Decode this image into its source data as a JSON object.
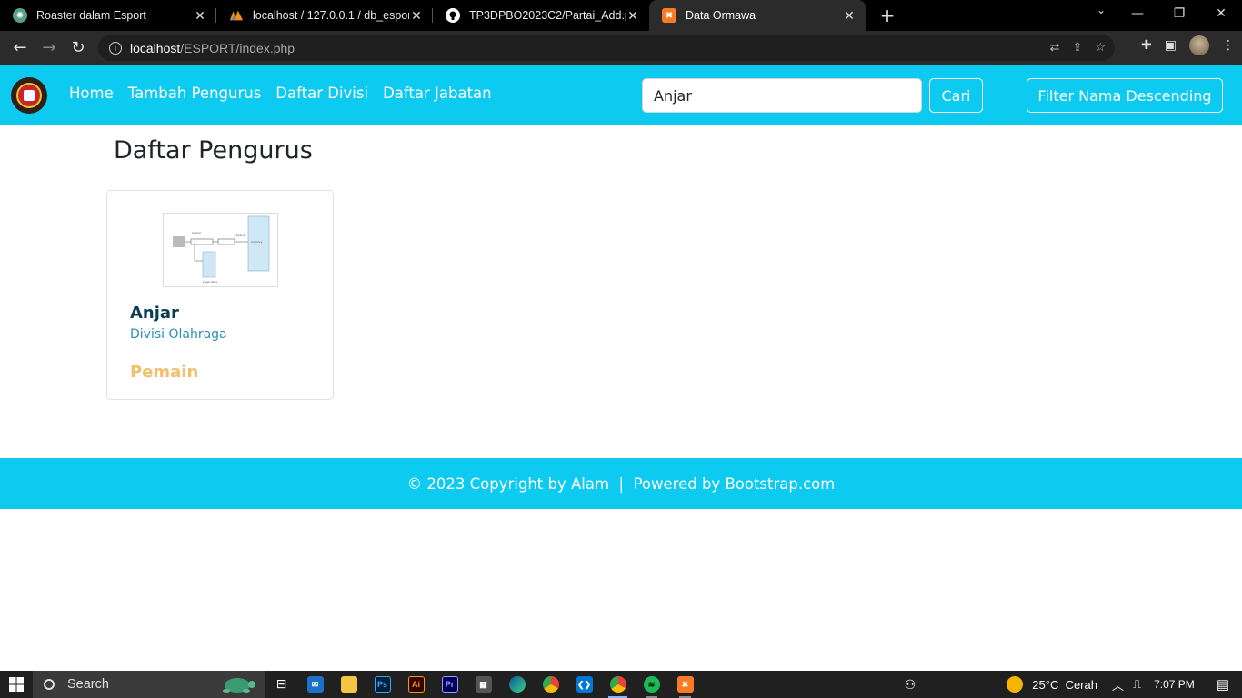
{
  "browser": {
    "tabs": [
      {
        "title": "Roaster dalam Esport",
        "icon": "chatgpt-icon",
        "active": false
      },
      {
        "title": "localhost / 127.0.0.1 / db_esport",
        "icon": "phpmyadmin-icon",
        "active": false
      },
      {
        "title": "TP3DPBO2023C2/Partai_Add.png",
        "icon": "github-icon",
        "active": false
      },
      {
        "title": "Data Ormawa",
        "icon": "xampp-icon",
        "active": true
      }
    ],
    "url_host": "localhost",
    "url_path": "/ESPORT/index.php"
  },
  "navbar": {
    "links": [
      "Home",
      "Tambah Pengurus",
      "Daftar Divisi",
      "Daftar Jabatan"
    ],
    "search_value": "Anjar",
    "search_button": "Cari",
    "filter_button": "Filter Nama Descending"
  },
  "main": {
    "title": "Daftar Pengurus",
    "cards": [
      {
        "name": "Anjar",
        "divisi": "Divisi Olahraga",
        "jabatan": "Pemain"
      }
    ]
  },
  "footer": {
    "text": "© 2023 Copyright by Alam  |  Powered by Bootstrap.com"
  },
  "taskbar": {
    "search_label": "Search",
    "weather": "25°C  Cerah",
    "time": "7:07 PM"
  },
  "colors": {
    "primary": "#0dcaf0",
    "card_name": "#0a3d52",
    "card_divisi": "#2a8fb8",
    "card_jabatan": "#f0c070"
  }
}
